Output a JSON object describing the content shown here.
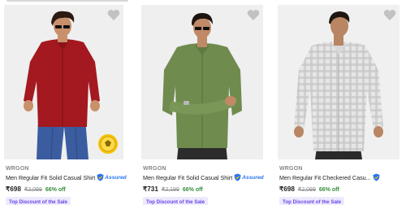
{
  "products": [
    {
      "brand": "WRGON",
      "title": "Men Regular Fit Solid Casual Shirt",
      "assured": "Assured",
      "price": "₹698",
      "mrp": "₹2,099",
      "discount": "66% off",
      "tag": "Top Discount of the Sale",
      "image_icon": "red-shirt-photo",
      "has_badge": true
    },
    {
      "brand": "WRGON",
      "title": "Men Regular Fit Solid Casual Shirt",
      "assured": "Assured",
      "price": "₹731",
      "mrp": "₹2,199",
      "discount": "66% off",
      "tag": "Top Discount of the Sale",
      "image_icon": "olive-shirt-photo",
      "has_badge": false
    },
    {
      "brand": "WRGON",
      "title": "Men Regular Fit Checkered Casu...",
      "assured": "Assured",
      "price": "₹698",
      "mrp": "₹2,099",
      "discount": "66% off",
      "tag": "Top Discount of the Sale",
      "image_icon": "checkered-shirt-photo",
      "has_badge": false
    }
  ],
  "colors": {
    "price_off": "#388e3c",
    "assured": "#2874f0",
    "tag_text": "#6d44e8",
    "tag_bg": "#ecebfd"
  }
}
